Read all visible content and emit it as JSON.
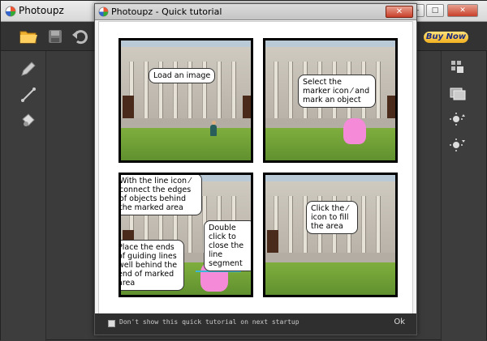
{
  "app": {
    "title": "Photoupz",
    "buy_label": "Buy Now",
    "window_buttons": [
      "—",
      "□",
      "✕"
    ]
  },
  "dialog": {
    "title": "Photoupz - Quick tutorial",
    "close_label": "✕",
    "panels": [
      {
        "caption": "Load an image"
      },
      {
        "caption": "Select the marker icon ⁄ and mark an object"
      },
      {
        "caption_a": "With the line icon ⁄ connect the edges of objects behind the marked area",
        "caption_b": "Double click to close the line segment",
        "caption_c": "Place the ends of guiding lines well behind the end of marked area"
      },
      {
        "caption": "Click the ⁄ icon to fill the area"
      }
    ],
    "footer": {
      "checkbox_label": "Don't show this quick tutorial on next startup",
      "ok_label": "Ok"
    }
  },
  "icons": {
    "toolbar": [
      "open-folder-icon",
      "save-icon",
      "undo-icon"
    ],
    "left_tools": [
      "pencil-icon",
      "line-icon",
      "fill-bucket-icon"
    ],
    "right_tools": [
      "dots-icon",
      "images-icon",
      "brightness-up-icon",
      "brightness-down-icon"
    ]
  },
  "colors": {
    "accent_buy": "#f0b020",
    "marker_pink": "#f48ad8",
    "line_cyan": "#3ab8d8"
  }
}
